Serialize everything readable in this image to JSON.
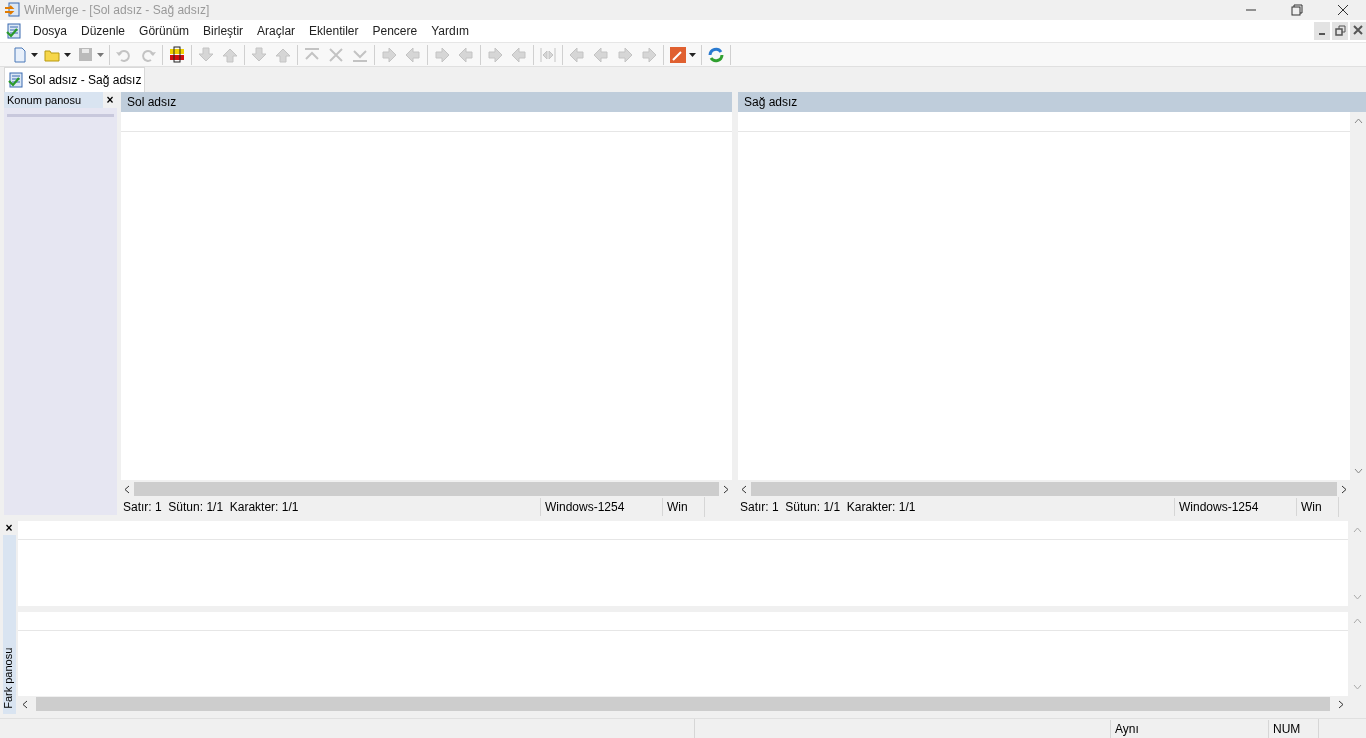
{
  "window": {
    "title": "WinMerge - [Sol adsız - Sağ adsız]"
  },
  "menu": [
    "Dosya",
    "Düzenle",
    "Görünüm",
    "Birleştir",
    "Araçlar",
    "Eklentiler",
    "Pencere",
    "Yardım"
  ],
  "toolbar": [
    [
      {
        "kind": "new-doc",
        "disabled": false,
        "dropdown": true
      },
      {
        "kind": "folder",
        "disabled": false,
        "dropdown": true
      },
      {
        "kind": "save",
        "disabled": true,
        "dropdown": true
      }
    ],
    [
      {
        "kind": "undo",
        "disabled": true,
        "dropdown": false
      },
      {
        "kind": "redo",
        "disabled": true,
        "dropdown": false
      }
    ],
    [
      {
        "kind": "marker",
        "disabled": false,
        "dropdown": false
      }
    ],
    [
      {
        "kind": "down",
        "disabled": true,
        "dropdown": false
      },
      {
        "kind": "up",
        "disabled": true,
        "dropdown": false
      }
    ],
    [
      {
        "kind": "down",
        "disabled": true,
        "dropdown": false
      },
      {
        "kind": "up",
        "disabled": true,
        "dropdown": false
      }
    ],
    [
      {
        "kind": "first",
        "disabled": true,
        "dropdown": false
      },
      {
        "kind": "current",
        "disabled": true,
        "dropdown": false
      },
      {
        "kind": "last",
        "disabled": true,
        "dropdown": false
      }
    ],
    [
      {
        "kind": "right",
        "disabled": true,
        "dropdown": false
      },
      {
        "kind": "left",
        "disabled": true,
        "dropdown": false
      }
    ],
    [
      {
        "kind": "right",
        "disabled": true,
        "dropdown": false
      },
      {
        "kind": "left",
        "disabled": true,
        "dropdown": false
      }
    ],
    [
      {
        "kind": "right",
        "disabled": true,
        "dropdown": false
      },
      {
        "kind": "left",
        "disabled": true,
        "dropdown": false
      }
    ],
    [
      {
        "kind": "all",
        "disabled": true,
        "dropdown": false
      }
    ],
    [
      {
        "kind": "left",
        "disabled": true,
        "dropdown": false
      },
      {
        "kind": "left",
        "disabled": true,
        "dropdown": false
      },
      {
        "kind": "right",
        "disabled": true,
        "dropdown": false
      },
      {
        "kind": "right",
        "disabled": true,
        "dropdown": false
      }
    ],
    [
      {
        "kind": "options",
        "disabled": false,
        "dropdown": true
      }
    ],
    [
      {
        "kind": "refresh",
        "disabled": false,
        "dropdown": false
      }
    ]
  ],
  "tabs": [
    {
      "label": "Sol adsız - Sağ adsız",
      "selected": true
    }
  ],
  "location_pane": {
    "title": "Konum panosu",
    "close": "×"
  },
  "panes": [
    {
      "title": "Sol adsız",
      "status": "Satır: 1  Sütun: 1/1  Karakter: 1/1",
      "encoding": "Windows-1254",
      "eol": "Win"
    },
    {
      "title": "Sağ adsız",
      "status": "Satır: 1  Sütun: 1/1  Karakter: 1/1",
      "encoding": "Windows-1254",
      "eol": "Win"
    }
  ],
  "diff_pane": {
    "title": "Fark panosu",
    "close": "×"
  },
  "status_bar": {
    "comparison": "Aynı",
    "num_lock": "NUM"
  }
}
